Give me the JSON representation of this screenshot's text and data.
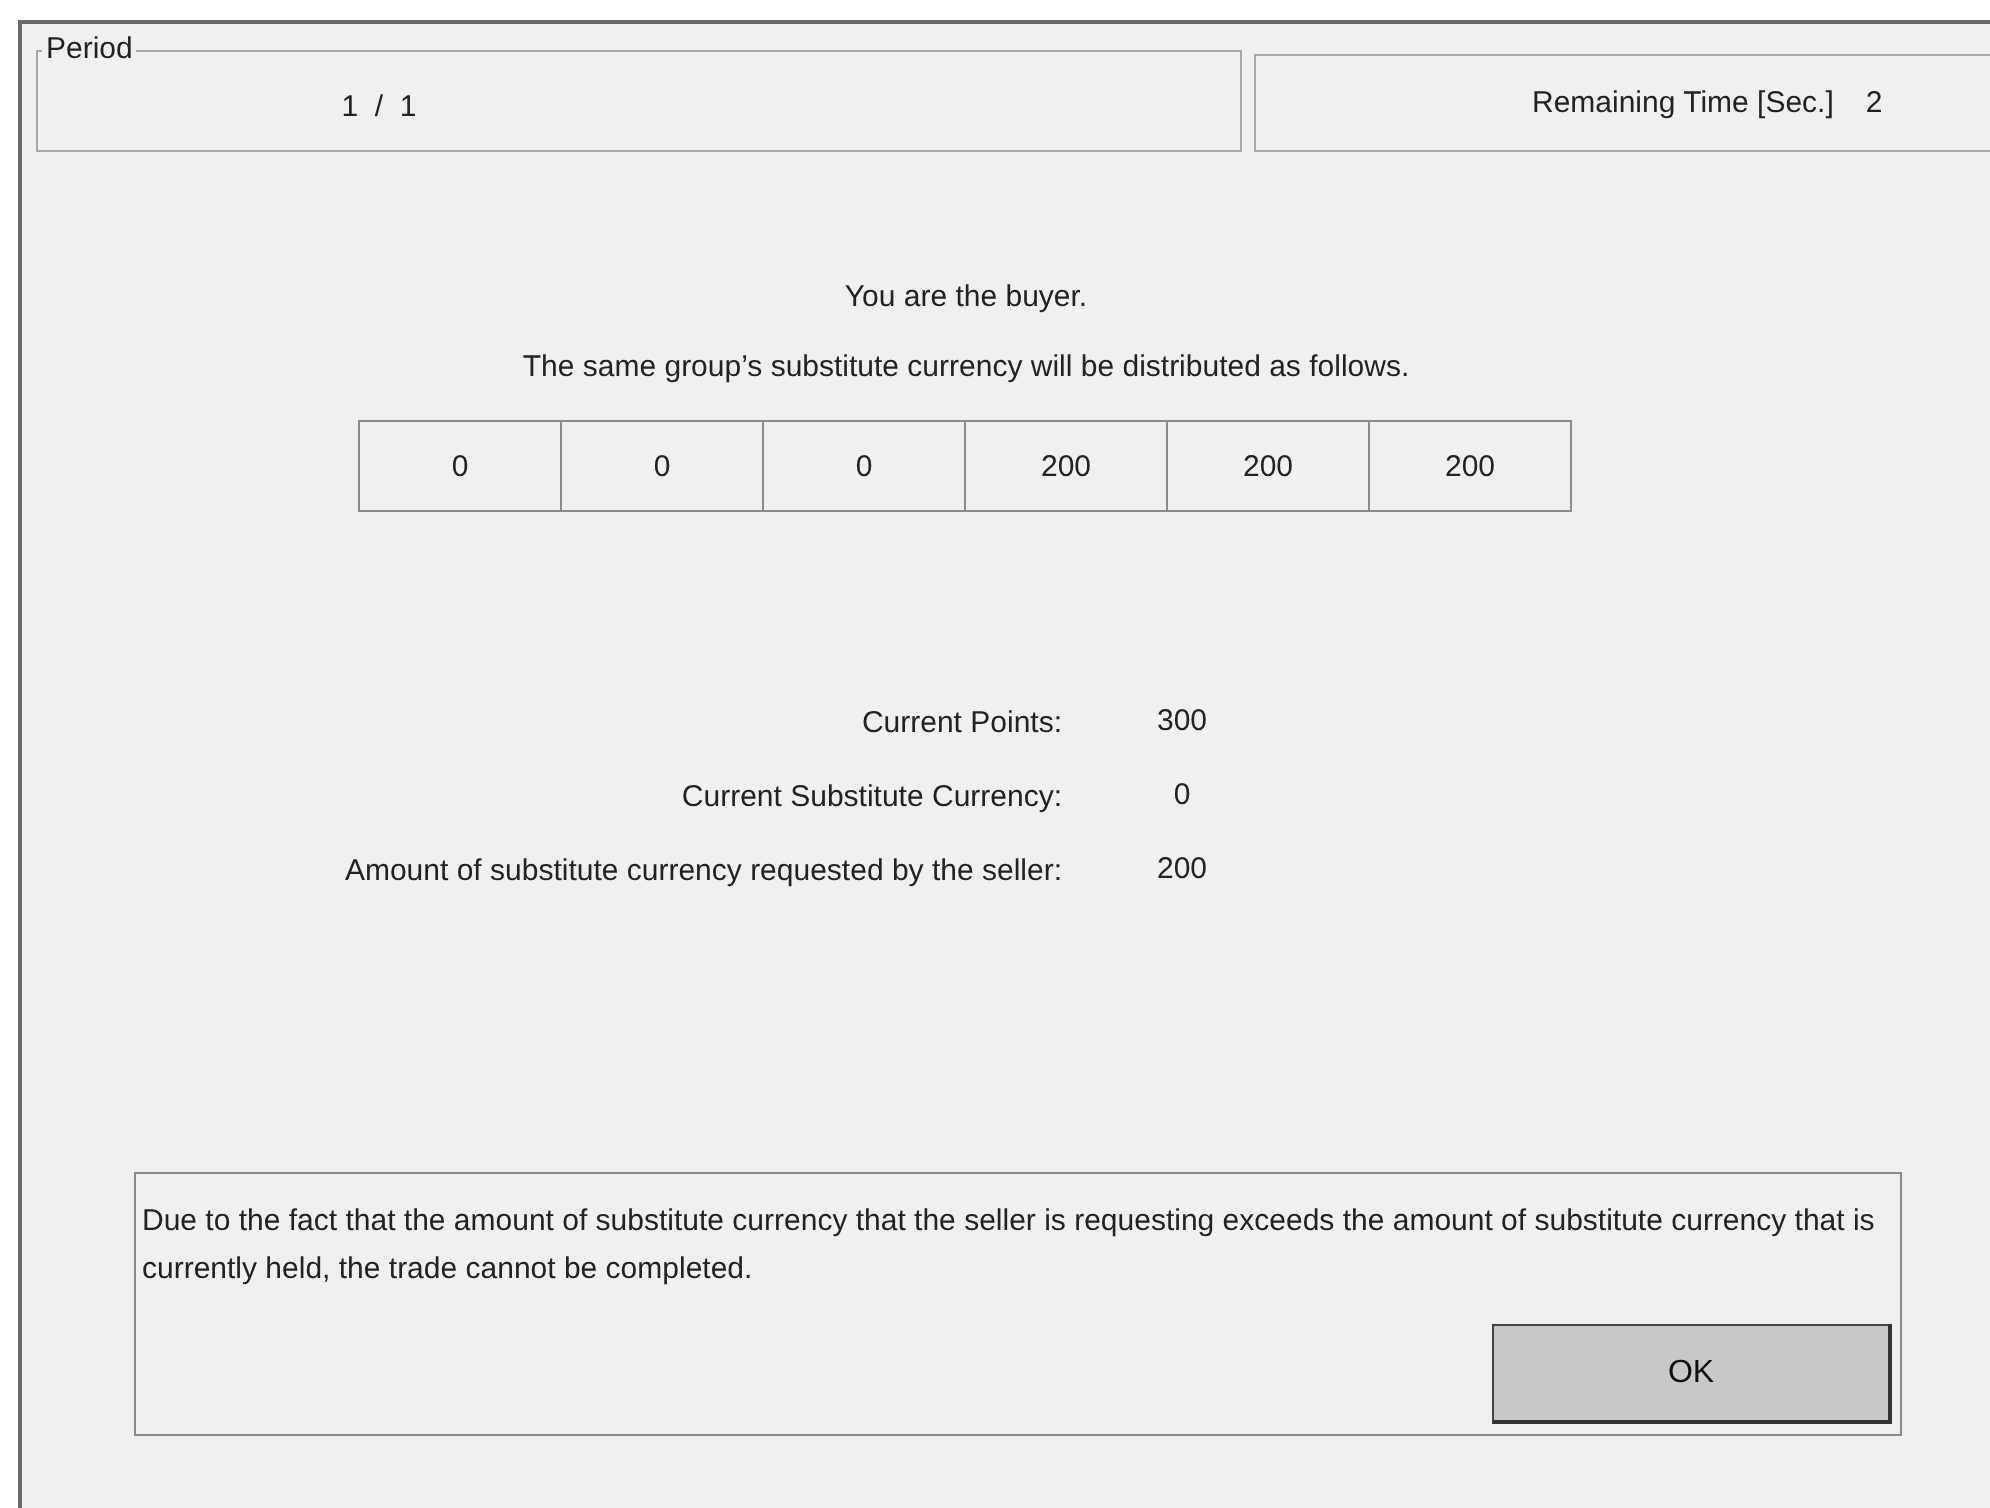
{
  "period": {
    "label": "Period",
    "value": "1  /  1"
  },
  "remaining_time": {
    "label": "Remaining Time [Sec.]",
    "value": "2"
  },
  "role_text": "You are the buyer.",
  "distribution_text": "The same group’s substitute currency will be distributed as follows.",
  "distribution": [
    "0",
    "0",
    "0",
    "200",
    "200",
    "200"
  ],
  "stats": [
    {
      "label": "Current Points:",
      "value": "300"
    },
    {
      "label": "Current Substitute Currency:",
      "value": "0"
    },
    {
      "label": "Amount of substitute currency requested by the seller:",
      "value": "200"
    }
  ],
  "message": {
    "text": "Due to the fact that the amount of substitute currency that the seller is requesting exceeds the amount of substitute currency that is currently held, the trade cannot be completed.",
    "button": "OK"
  }
}
